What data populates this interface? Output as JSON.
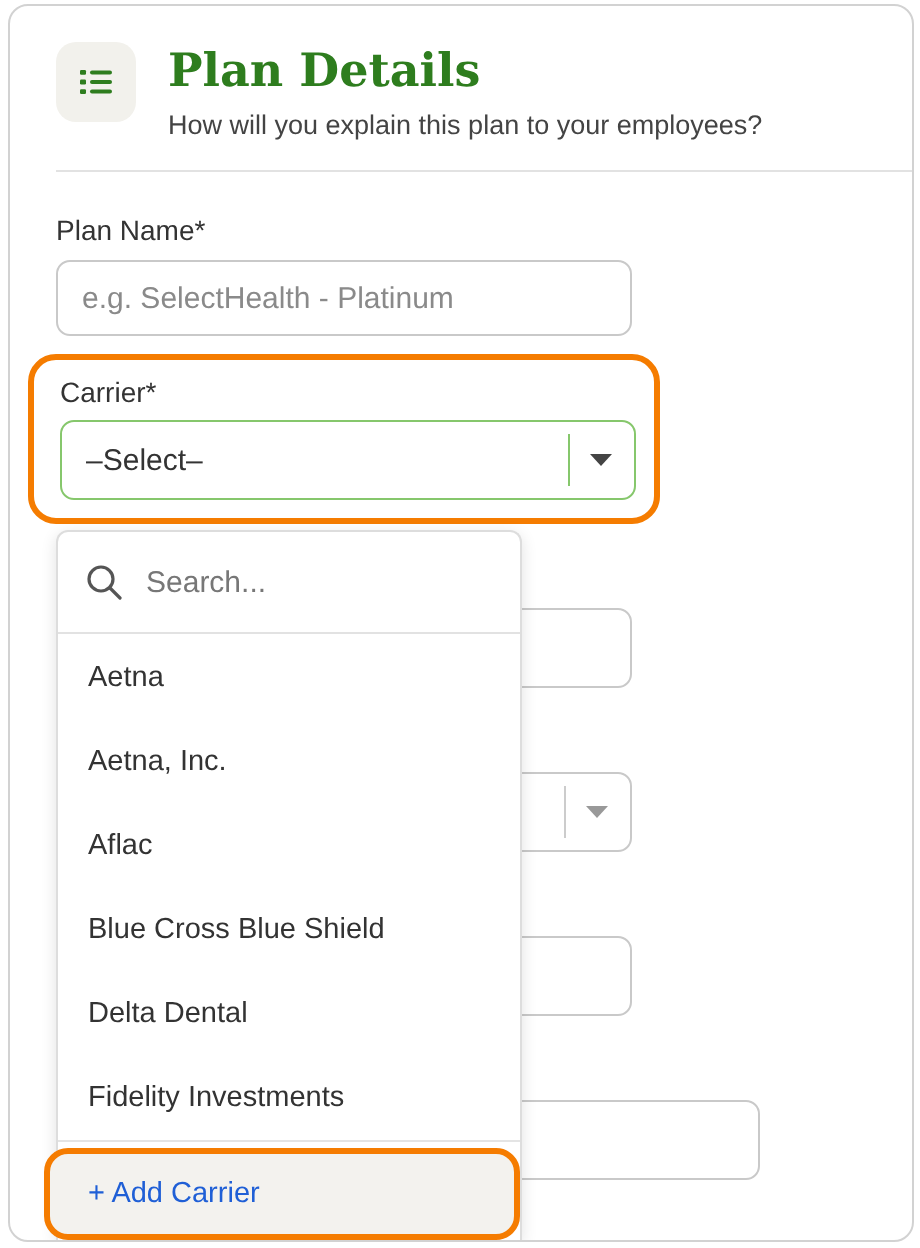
{
  "header": {
    "title": "Plan Details",
    "subtitle": "How will you explain this plan to your employees?"
  },
  "plan_name": {
    "label": "Plan Name*",
    "placeholder": "e.g. SelectHealth - Platinum"
  },
  "carrier": {
    "label": "Carrier*",
    "value": "–Select–",
    "highlighted": true,
    "expanded": true
  },
  "hidden_fields": [
    {
      "kind": "input"
    },
    {
      "kind": "select"
    },
    {
      "kind": "input"
    },
    {
      "kind": "wide"
    }
  ],
  "dropdown": {
    "search_placeholder": "Search...",
    "options": [
      {
        "label": "Aetna"
      },
      {
        "label": "Aetna, Inc."
      },
      {
        "label": "Aflac"
      },
      {
        "label": "Blue Cross Blue Shield"
      },
      {
        "label": "Delta Dental"
      },
      {
        "label": "Fidelity Investments"
      }
    ],
    "add": {
      "label": "+ Add Carrier",
      "highlighted": true
    }
  }
}
